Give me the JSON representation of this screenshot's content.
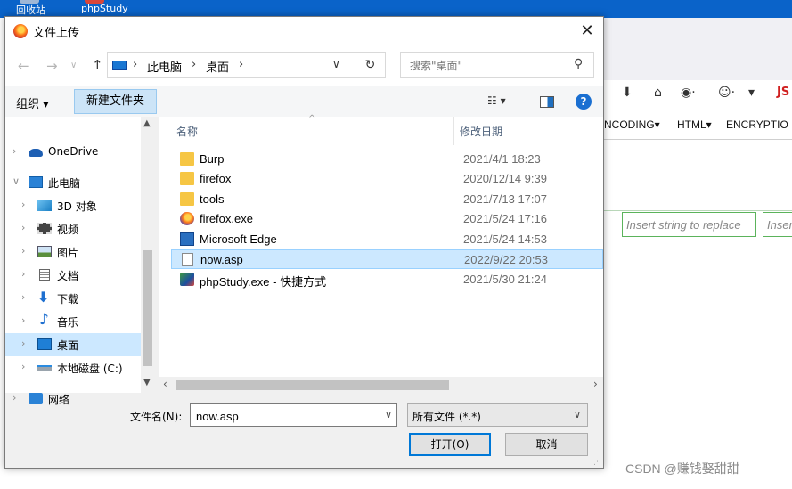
{
  "desktop": {
    "icons": [
      {
        "label": "回收站",
        "color": "#9fb7d6"
      },
      {
        "label": "phpStudy",
        "color": "#d8463a"
      }
    ]
  },
  "background_browser": {
    "menu": [
      "NCODING▾",
      "HTML▾",
      "ENCRYPTIO"
    ],
    "js_label": "JS",
    "inputs": [
      {
        "placeholder": "Insert string to replace"
      },
      {
        "placeholder": "Inser"
      }
    ],
    "watermark": "CSDN @赚钱娶甜甜"
  },
  "dialog": {
    "title": "文件上传",
    "close_glyph": "✕",
    "nav": {
      "back_glyph": "←",
      "forward_glyph": "→",
      "recent_glyph": "∨",
      "up_glyph": "↑",
      "address": [
        "此电脑",
        "桌面"
      ],
      "address_sep": "›",
      "dropdown_glyph": "∨",
      "refresh_glyph": "↻",
      "search_placeholder": "搜索\"桌面\"",
      "search_glyph": "⚲"
    },
    "toolbar": {
      "organize": "组织 ▾",
      "new_folder": "新建文件夹",
      "view_glyph": "☷ ▾",
      "help_glyph": "?"
    },
    "sidebar": {
      "items": [
        {
          "label": "OneDrive",
          "icon": "cloud-icon",
          "expand": "›"
        },
        {
          "label": "此电脑",
          "icon": "computer-icon",
          "expand": "∨"
        },
        {
          "label": "3D 对象",
          "icon": "cube-icon",
          "expand": "›"
        },
        {
          "label": "视频",
          "icon": "video-icon",
          "expand": "›"
        },
        {
          "label": "图片",
          "icon": "picture-icon",
          "expand": "›"
        },
        {
          "label": "文档",
          "icon": "document-icon",
          "expand": "›"
        },
        {
          "label": "下载",
          "icon": "download-icon",
          "expand": "›"
        },
        {
          "label": "音乐",
          "icon": "music-icon",
          "expand": "›"
        },
        {
          "label": "桌面",
          "icon": "desktop-icon",
          "expand": "›",
          "selected": true
        },
        {
          "label": "本地磁盘 (C:)",
          "icon": "drive-icon",
          "expand": "›"
        },
        {
          "label": "网络",
          "icon": "network-icon",
          "expand": "›"
        }
      ]
    },
    "columns": {
      "name": "名称",
      "modified": "修改日期",
      "sort_glyph": "^"
    },
    "files": [
      {
        "name": "Burp",
        "date": "2021/4/1 18:23",
        "icon": "folder-icon"
      },
      {
        "name": "firefox",
        "date": "2020/12/14 9:39",
        "icon": "folder-icon"
      },
      {
        "name": "tools",
        "date": "2021/7/13 17:07",
        "icon": "folder-icon"
      },
      {
        "name": "firefox.exe",
        "date": "2021/5/24 17:16",
        "icon": "firefox-icon"
      },
      {
        "name": "Microsoft Edge",
        "date": "2021/5/24 14:53",
        "icon": "edge-icon"
      },
      {
        "name": "now.asp",
        "date": "2022/9/22 20:53",
        "icon": "file-icon",
        "selected": true
      },
      {
        "name": "phpStudy.exe - 快捷方式",
        "date": "2021/5/30 21:24",
        "icon": "phpstudy-shortcut-icon"
      }
    ],
    "bottom": {
      "filename_label": "文件名(N):",
      "filename_value": "now.asp",
      "filetype_value": "所有文件 (*.*)",
      "open_button": "打开(O)",
      "cancel_button": "取消"
    }
  }
}
